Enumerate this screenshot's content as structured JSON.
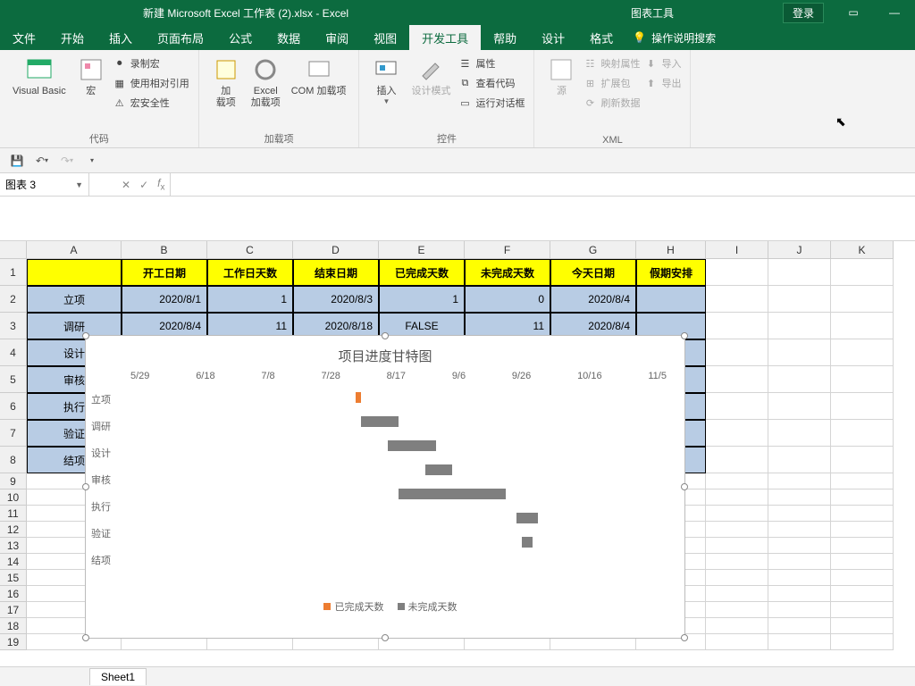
{
  "title": {
    "document": "新建 Microsoft Excel 工作表 (2).xlsx  -  Excel",
    "tool_context": "图表工具"
  },
  "titlebar": {
    "login": "登录"
  },
  "menu": {
    "items": [
      "文件",
      "开始",
      "插入",
      "页面布局",
      "公式",
      "数据",
      "审阅",
      "视图",
      "开发工具",
      "帮助",
      "设计",
      "格式"
    ],
    "active_index": 8,
    "search_placeholder": "操作说明搜索"
  },
  "ribbon": {
    "code": {
      "vb": "Visual Basic",
      "macro": "宏",
      "record": "录制宏",
      "relative": "使用相对引用",
      "security": "宏安全性",
      "group": "代码"
    },
    "addins": {
      "addin": "加\n载项",
      "excel": "Excel\n加载项",
      "com": "COM 加载项",
      "group": "加载项"
    },
    "controls": {
      "insert": "插入",
      "design": "设计模式",
      "props": "属性",
      "viewcode": "查看代码",
      "rundlg": "运行对话框",
      "group": "控件"
    },
    "xml": {
      "source": "源",
      "mapprops": "映射属性",
      "expand": "扩展包",
      "refresh": "刷新数据",
      "import": "导入",
      "export": "导出",
      "group": "XML"
    }
  },
  "namebox": {
    "value": "图表 3"
  },
  "columns": [
    "A",
    "B",
    "C",
    "D",
    "E",
    "F",
    "G",
    "H",
    "I",
    "J",
    "K"
  ],
  "row_numbers": [
    1,
    2,
    3,
    4,
    5,
    6,
    7,
    8,
    9,
    10,
    11,
    12,
    13,
    14,
    15,
    16,
    17,
    18,
    19
  ],
  "headers": {
    "A": "",
    "B": "开工日期",
    "C": "工作日天数",
    "D": "结束日期",
    "E": "已完成天数",
    "F": "未完成天数",
    "G": "今天日期",
    "H": "假期安排"
  },
  "data_rows": [
    {
      "A": "立项",
      "B": "2020/8/1",
      "C": "1",
      "D": "2020/8/3",
      "E": "1",
      "F": "0",
      "G": "2020/8/4",
      "H": ""
    },
    {
      "A": "调研",
      "B": "2020/8/4",
      "C": "11",
      "D": "2020/8/18",
      "E": "FALSE",
      "F": "11",
      "G": "2020/8/4",
      "H": ""
    }
  ],
  "partial_rows": [
    "设计",
    "审核",
    "执行",
    "验证",
    "结项"
  ],
  "chart_data": {
    "type": "bar",
    "title": "项目进度甘特图",
    "x_ticks": [
      "5/29",
      "6/18",
      "7/8",
      "7/28",
      "8/17",
      "9/6",
      "9/26",
      "10/16",
      "11/5"
    ],
    "categories": [
      "立项",
      "调研",
      "设计",
      "审核",
      "执行",
      "验证",
      "结项"
    ],
    "series": [
      {
        "name": "已完成天数",
        "color": "#ed7d31",
        "values": [
          1,
          0,
          0,
          0,
          0,
          0,
          0
        ]
      },
      {
        "name": "未完成天数",
        "color": "#7f7f7f",
        "values": [
          0,
          11,
          14,
          7,
          30,
          7,
          3
        ]
      }
    ],
    "start_offsets_pct": [
      42,
      43,
      48,
      55,
      50,
      72,
      73
    ],
    "done_widths_pct": [
      1,
      0,
      0,
      0,
      0,
      0,
      0
    ],
    "todo_widths_pct": [
      0,
      7,
      9,
      5,
      20,
      4,
      2
    ],
    "legend": {
      "done": "已完成天数",
      "todo": "未完成天数"
    }
  },
  "sheet": {
    "tab": "Sheet1"
  }
}
